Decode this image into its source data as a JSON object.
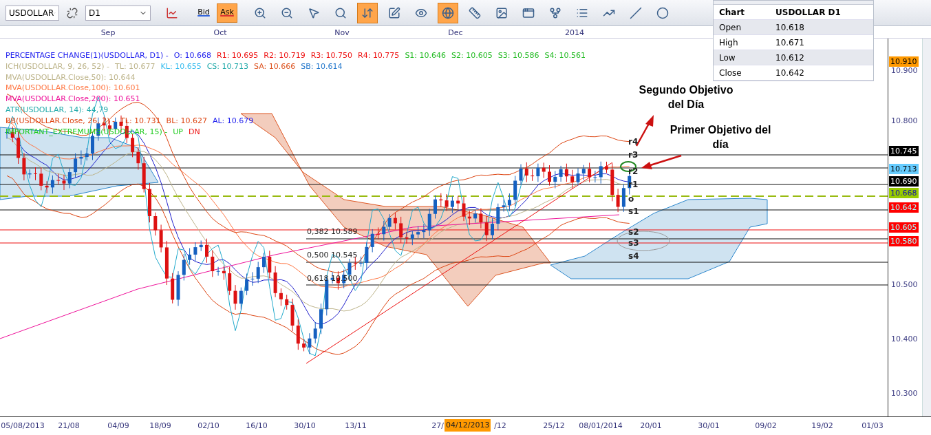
{
  "toolbar": {
    "symbol": "USDOLLAR",
    "timeframe": "D1",
    "price_buttons": [
      {
        "label": "Bid",
        "selected": false
      },
      {
        "label": "Ask",
        "selected": true
      }
    ],
    "tools": [
      {
        "kind": "unlink",
        "active": false
      },
      {
        "kind": "chart-style",
        "active": false
      },
      {
        "kind": "zoom-in",
        "active": false
      },
      {
        "kind": "zoom-out",
        "active": false
      },
      {
        "kind": "pointer",
        "active": false
      },
      {
        "kind": "zoom-range",
        "active": false
      },
      {
        "kind": "autoscale",
        "active": true
      },
      {
        "kind": "edit",
        "active": false
      },
      {
        "kind": "eye",
        "active": false
      },
      {
        "kind": "globe",
        "active": true
      },
      {
        "kind": "ruler",
        "active": false
      },
      {
        "kind": "image",
        "active": false
      },
      {
        "kind": "window",
        "active": false
      },
      {
        "kind": "fork",
        "active": false
      },
      {
        "kind": "list",
        "active": false
      },
      {
        "kind": "fan",
        "active": false
      },
      {
        "kind": "line",
        "active": false
      },
      {
        "kind": "ellipse",
        "active": false
      }
    ]
  },
  "months": [
    "Sep",
    "Oct",
    "Nov",
    "Dec",
    "2014"
  ],
  "legend": [
    {
      "parts": [
        {
          "text": "PERCENTAGE CHANGE(1)(USDOLLAR, D1) -",
          "color": "#2222ee"
        },
        {
          "text": "O: 10.668",
          "color": "#2222ee"
        },
        {
          "text": "R1: 10.695",
          "color": "#ee1111"
        },
        {
          "text": "R2: 10.719",
          "color": "#ee1111"
        },
        {
          "text": "R3: 10.750",
          "color": "#ee1111"
        },
        {
          "text": "R4: 10.775",
          "color": "#ee1111"
        },
        {
          "text": "S1: 10.646",
          "color": "#22bb22"
        },
        {
          "text": "S2: 10.605",
          "color": "#22bb22"
        },
        {
          "text": "S3: 10.586",
          "color": "#22bb22"
        },
        {
          "text": "S4: 10.561",
          "color": "#22bb22"
        }
      ]
    },
    {
      "parts": [
        {
          "text": "ICH(USDOLLAR, 9, 26, 52) -",
          "color": "#bdb48a"
        },
        {
          "text": "TL: 10.677",
          "color": "#bdb48a"
        },
        {
          "text": "KL: 10.655",
          "color": "#33bbee"
        },
        {
          "text": "CS: 10.713",
          "color": "#22aaaa"
        },
        {
          "text": "SA: 10.666",
          "color": "#dd5522"
        },
        {
          "text": "SB: 10.614",
          "color": "#2277cc"
        }
      ]
    },
    {
      "parts": [
        {
          "text": "MVA(USDOLLAR.Close,50): 10.644",
          "color": "#bdb48a"
        }
      ]
    },
    {
      "parts": [
        {
          "text": "MVA(USDOLLAR.Close,100): 10.601",
          "color": "#ff7744"
        }
      ]
    },
    {
      "parts": [
        {
          "text": "MVA(USDOLLAR.Close,200): 10.651",
          "color": "#ee1199"
        }
      ]
    },
    {
      "parts": [
        {
          "text": "ATR(USDOLLAR, 14): 44,79",
          "color": "#22aaaa"
        }
      ]
    },
    {
      "parts": [
        {
          "text": "BB(USDOLLAR.Close, 26, 2) -",
          "color": "#dd4411"
        },
        {
          "text": "TL: 10.731",
          "color": "#dd4411"
        },
        {
          "text": "BL: 10.627",
          "color": "#dd4411"
        },
        {
          "text": "AL: 10.679",
          "color": "#2222ee"
        }
      ]
    },
    {
      "parts": [
        {
          "text": "IMPORTANT_EXTREMUMS(USDOLLAR, 15) -",
          "color": "#22cc22"
        },
        {
          "text": "UP",
          "color": "#22cc22"
        },
        {
          "text": "DN",
          "color": "#ee1111"
        }
      ]
    }
  ],
  "levels": [
    {
      "text": "r4"
    },
    {
      "text": "r3"
    },
    {
      "text": "r2"
    },
    {
      "text": "r1"
    },
    {
      "text": "o"
    },
    {
      "text": "s1"
    },
    {
      "text": "s2"
    },
    {
      "text": "s3"
    },
    {
      "text": "s4"
    }
  ],
  "fibonacci": [
    "0,382 10.589",
    "0,500 10.545",
    "0,618 10.500"
  ],
  "annotations": [
    "Segundo Objetivo del Día",
    "Primer Objetivo del día"
  ],
  "price_axis": [
    "10.900",
    "10.800",
    "10.500",
    "10.400",
    "10.300"
  ],
  "price_markers": [
    {
      "text": "10.910",
      "color": "#ff9900"
    },
    {
      "text": "10.745",
      "color": "#000000"
    },
    {
      "text": "10.713",
      "color": "#66ccff"
    },
    {
      "text": "10.690",
      "color": "#000000"
    },
    {
      "text": "10.668",
      "color": "#99cc00"
    },
    {
      "text": "10.642",
      "color": "#ff0000"
    },
    {
      "text": "10.605",
      "color": "#ff0000"
    },
    {
      "text": "10.580",
      "color": "#ff0000"
    }
  ],
  "info_panel": {
    "rows": [
      {
        "name": "Chart",
        "value": "USDOLLAR D1"
      },
      {
        "name": "Open",
        "value": "10.618"
      },
      {
        "name": "High",
        "value": "10.671"
      },
      {
        "name": "Low",
        "value": "10.612"
      },
      {
        "name": "Close",
        "value": "10.642"
      }
    ]
  },
  "dates": [
    "05/08/2013",
    "21/08",
    "04/09",
    "18/09",
    "02/10",
    "16/10",
    "30/10",
    "13/11",
    "27/",
    "/12",
    "25/12",
    "08/01/2014",
    "20/01",
    "30/01",
    "09/02",
    "19/02",
    "01/03"
  ],
  "cursor_date": "04/12/2013"
}
